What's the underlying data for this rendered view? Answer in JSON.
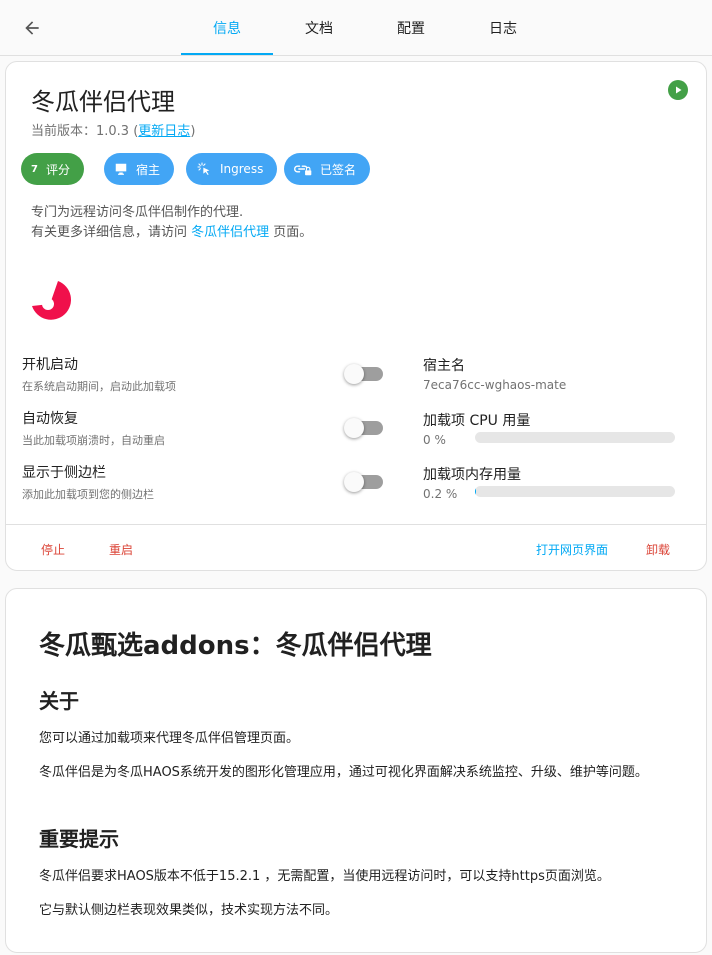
{
  "nav": {
    "tabs": [
      {
        "label": "信息"
      },
      {
        "label": "文档"
      },
      {
        "label": "配置"
      },
      {
        "label": "日志"
      }
    ],
    "active_tab": "信息"
  },
  "addon": {
    "name": "冬瓜伴侣代理",
    "version_prefix": "当前版本：1.0.3 (",
    "changelog_link": "更新日志",
    "version_suffix": ")",
    "chips": [
      {
        "rating": "7",
        "label": "评分",
        "color": "#43a047"
      },
      {
        "label": "宿主",
        "color": "#42a5f5"
      },
      {
        "label": "Ingress",
        "color": "#42a5f5"
      },
      {
        "label": "已签名",
        "color": "#42a5f5"
      }
    ],
    "description": "专门为远程访问冬瓜伴侣制作的代理.",
    "more_info_prefix": "有关更多详细信息，请访问 ",
    "more_info_link": "冬瓜伴侣代理",
    "more_info_suffix": " 页面。",
    "logo_color": "#f0104b",
    "options": [
      {
        "title": "开机启动",
        "subtitle": "在系统启动期间，启动此加载项",
        "enabled": false
      },
      {
        "title": "自动恢复",
        "subtitle": "当此加载项崩溃时，自动重启",
        "enabled": false
      },
      {
        "title": "显示于侧边栏",
        "subtitle": "添加此加载项到您的侧边栏",
        "enabled": false
      }
    ],
    "hostname_label": "宿主名",
    "hostname_value": "7eca76cc-wghaos-mate",
    "cpu_label": "加载项 CPU 用量",
    "cpu_value": "0 %",
    "cpu_fraction": 0,
    "memory_label": "加载项内存用量",
    "memory_value": "0.2 %",
    "memory_fraction": 0.002,
    "actions": {
      "stop": "停止",
      "restart": "重启",
      "open_web_ui": "打开网页界面",
      "uninstall": "卸载"
    }
  },
  "docs": {
    "title": "冬瓜甄选addons：冬瓜伴侣代理",
    "about_heading": "关于",
    "about_p1": "您可以通过加载项来代理冬瓜伴侣管理页面。",
    "about_p2": "冬瓜伴侣是为冬瓜HAOS系统开发的图形化管理应用，通过可视化界面解决系统监控、升级、维护等问题。",
    "notice_heading": "重要提示",
    "notice_p1": "冬瓜伴侣要求HAOS版本不低于15.2.1 ，无需配置，当使用远程访问时，可以支持https页面浏览。",
    "notice_p2": "它与默认侧边栏表现效果类似，技术实现方法不同。"
  },
  "colors": {
    "accent": "#03a9f4",
    "danger": "#db4437",
    "success": "#43a047"
  }
}
